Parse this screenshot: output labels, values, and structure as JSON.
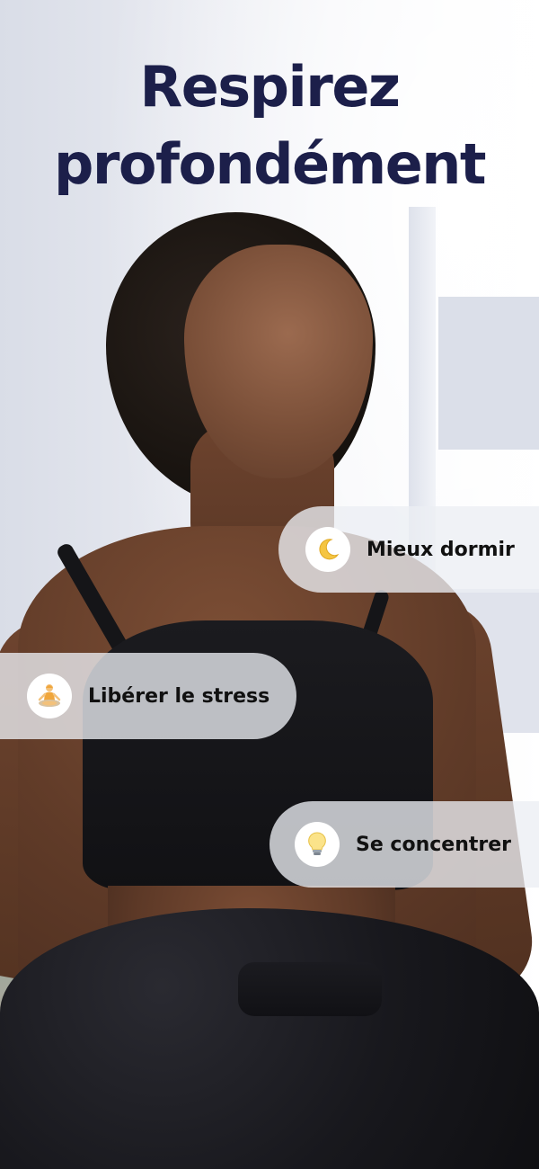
{
  "headline": {
    "line1": "Respirez",
    "line2": "profondément"
  },
  "benefits": [
    {
      "label": "Mieux dormir",
      "icon": "crescent-moon-icon"
    },
    {
      "label": "Libérer le stress",
      "icon": "meditation-person-icon"
    },
    {
      "label": "Se concentrer",
      "icon": "light-bulb-icon"
    }
  ],
  "colors": {
    "headline": "#1c1f4a",
    "pill_background": "#eceef4",
    "pill_text": "#111111"
  }
}
